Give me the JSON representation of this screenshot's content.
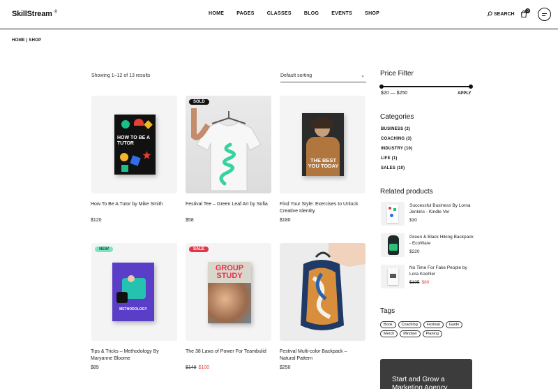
{
  "header": {
    "logo": "SkillStream",
    "logo_mark": "®",
    "nav": [
      "HOME",
      "PAGES",
      "CLASSES",
      "BLOG",
      "EVENTS",
      "SHOP"
    ],
    "search_label": "SEARCH",
    "cart_count": "0"
  },
  "breadcrumb": "HOME  |  SHOP",
  "shop": {
    "showing": "Showing 1–12 of 13 results",
    "sorting": "Default sorting",
    "products": [
      {
        "title": "How To Be A Tutor by Mike Smith",
        "price": "$120",
        "old_price": "",
        "badge": ""
      },
      {
        "title": "Festival Tee – Green Leaf Art by Sofia",
        "price": "$58",
        "old_price": "",
        "badge": "SOLD"
      },
      {
        "title": "Find Your Style: Exercises to Unlock Creative Identity",
        "price": "$180",
        "old_price": "",
        "badge": ""
      },
      {
        "title": "Tips & Tricks – Methodology By Maryanne Bloome",
        "price": "$89",
        "old_price": "",
        "badge": "NEW"
      },
      {
        "title": "The 38 Laws of Power For Teambulid",
        "price": "$100",
        "old_price": "$148",
        "badge": "SALE"
      },
      {
        "title": "Festival Multi-color Backpack – Natural Pattern",
        "price": "$250",
        "old_price": "",
        "badge": ""
      }
    ],
    "book_texts": {
      "tutor": "HOW TO BE A TUTOR",
      "style": "THE BEST YOU TODAY",
      "group": "GROUP STUDY",
      "method": "METHODOLOGY"
    }
  },
  "sidebar": {
    "price_filter": {
      "title": "Price Filter",
      "range": "$20 — $250",
      "apply": "APPLY"
    },
    "categories": {
      "title": "Categories",
      "items": [
        "BUSINESS (2)",
        "COACHING (3)",
        "INDUSTRY (10)",
        "LIFE (1)",
        "SALES (10)"
      ]
    },
    "related": {
      "title": "Related products",
      "items": [
        {
          "title": "Successful Business By Lorna Jenkins - Kindle Ver",
          "price": "$30",
          "old_price": ""
        },
        {
          "title": "Green & Black Hiking Backpack - EcoWare",
          "price": "$220",
          "old_price": ""
        },
        {
          "title": "No Time For Fake People by Lora Koehler",
          "price": "$80",
          "old_price": "$105"
        }
      ]
    },
    "tags": {
      "title": "Tags",
      "items": [
        "Book",
        "Coaching",
        "Festival",
        "Guide",
        "Merch",
        "Mindset",
        "Planing"
      ]
    },
    "promo": "Start and Grow a Marketing Agency"
  },
  "colors": {
    "sold_badge": "#111111",
    "new_badge": "#7fe3c2",
    "sale_badge": "#e8334a",
    "sale_price": "#e03b3b"
  }
}
